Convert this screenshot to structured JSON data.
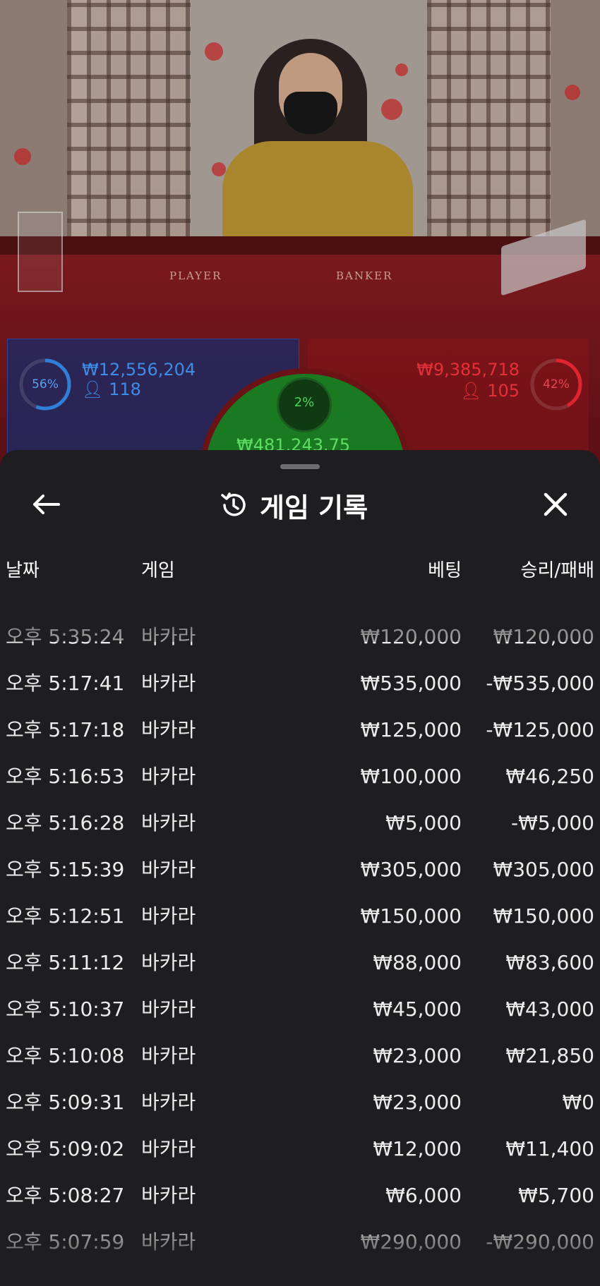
{
  "video": {
    "table_labels": [
      "PLAYER",
      "BANKER"
    ]
  },
  "bets": {
    "player": {
      "percent": "56%",
      "amount": "₩12,556,204",
      "count": "118",
      "color": "#2f7fd8"
    },
    "banker": {
      "percent": "42%",
      "amount": "₩9,385,718",
      "count": "105",
      "color": "#e0242f"
    },
    "tie": {
      "percent": "2%",
      "amount": "₩481,243.75",
      "color": "#3ec84a"
    }
  },
  "sheet": {
    "title": "게임 기록",
    "icons": {
      "back": "arrow-left-icon",
      "history": "history-icon",
      "close": "close-icon"
    },
    "columns": {
      "date": "날짜",
      "game": "게임",
      "bet": "베팅",
      "result": "승리/패배"
    },
    "rows": [
      {
        "date": "오후 5:35:24",
        "game": "바카라",
        "bet": "₩120,000",
        "result": "₩120,000"
      },
      {
        "date": "오후 5:17:41",
        "game": "바카라",
        "bet": "₩535,000",
        "result": "-₩535,000"
      },
      {
        "date": "오후 5:17:18",
        "game": "바카라",
        "bet": "₩125,000",
        "result": "-₩125,000"
      },
      {
        "date": "오후 5:16:53",
        "game": "바카라",
        "bet": "₩100,000",
        "result": "₩46,250"
      },
      {
        "date": "오후 5:16:28",
        "game": "바카라",
        "bet": "₩5,000",
        "result": "-₩5,000"
      },
      {
        "date": "오후 5:15:39",
        "game": "바카라",
        "bet": "₩305,000",
        "result": "₩305,000"
      },
      {
        "date": "오후 5:12:51",
        "game": "바카라",
        "bet": "₩150,000",
        "result": "₩150,000"
      },
      {
        "date": "오후 5:11:12",
        "game": "바카라",
        "bet": "₩88,000",
        "result": "₩83,600"
      },
      {
        "date": "오후 5:10:37",
        "game": "바카라",
        "bet": "₩45,000",
        "result": "₩43,000"
      },
      {
        "date": "오후 5:10:08",
        "game": "바카라",
        "bet": "₩23,000",
        "result": "₩21,850"
      },
      {
        "date": "오후 5:09:31",
        "game": "바카라",
        "bet": "₩23,000",
        "result": "₩0"
      },
      {
        "date": "오후 5:09:02",
        "game": "바카라",
        "bet": "₩12,000",
        "result": "₩11,400"
      },
      {
        "date": "오후 5:08:27",
        "game": "바카라",
        "bet": "₩6,000",
        "result": "₩5,700"
      },
      {
        "date": "오후 5:07:59",
        "game": "바카라",
        "bet": "₩290,000",
        "result": "-₩290,000"
      }
    ]
  }
}
